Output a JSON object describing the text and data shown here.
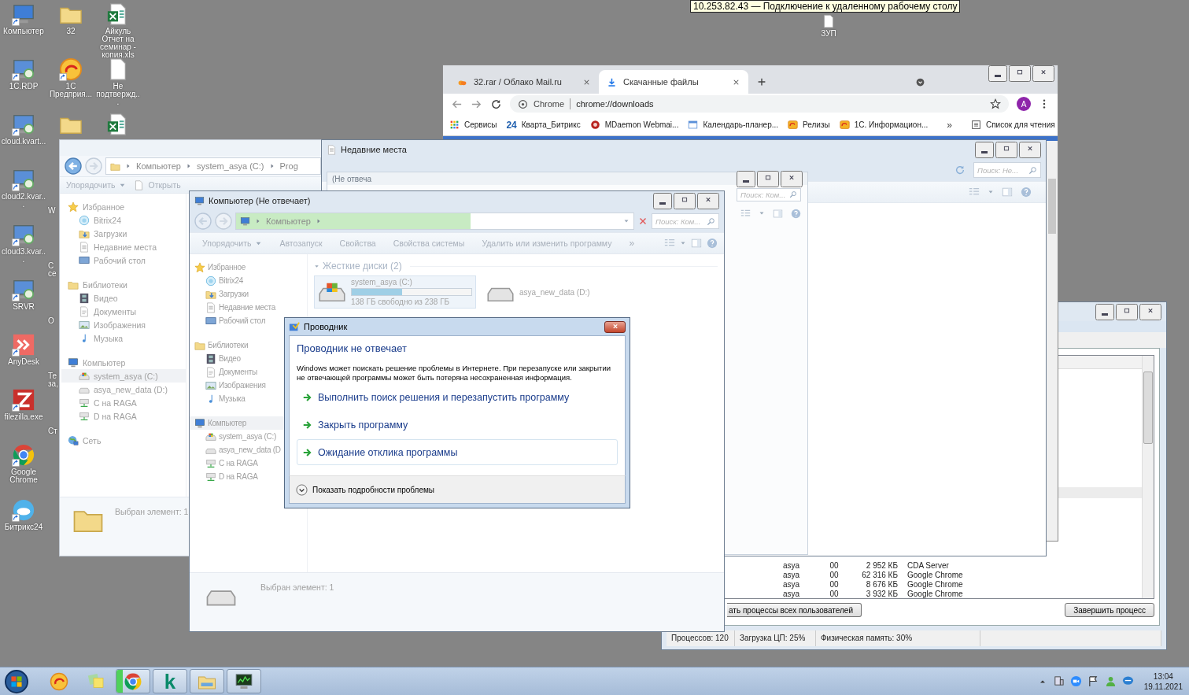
{
  "remote_session": {
    "title": "10.253.82.43 — Подключение к удаленному рабочему столу"
  },
  "desktop_columns": [
    [
      {
        "label": "Компьютер",
        "kind": "computer",
        "shortcut": true
      },
      {
        "label": "1C.RDP",
        "kind": "rdp",
        "shortcut": true
      },
      {
        "label": "cloud.kvart...",
        "kind": "rdp",
        "shortcut": true
      },
      {
        "label": "cloud2.kvar...",
        "kind": "rdp",
        "shortcut": true
      },
      {
        "label": "cloud3.kvar...",
        "kind": "rdp",
        "shortcut": true
      },
      {
        "label": "SRVR",
        "kind": "rdp",
        "shortcut": true
      },
      {
        "label": "AnyDesk",
        "kind": "anydesk",
        "shortcut": true
      },
      {
        "label": "filezilla.exe",
        "kind": "filezilla",
        "shortcut": true
      },
      {
        "label": "Google Chrome",
        "kind": "chrome",
        "shortcut": true
      },
      {
        "label": "Битрикс24",
        "kind": "cloudb",
        "shortcut": true
      }
    ],
    [
      {
        "label": "32",
        "kind": "folder",
        "shortcut": false
      },
      {
        "label": "1С Предприя...",
        "kind": "onec",
        "shortcut": true
      },
      {
        "kind": "folder",
        "shortcut": false
      },
      {
        "label": "W",
        "kind": "hidden",
        "shortcut": false
      },
      {
        "label": "С се",
        "kind": "hidden",
        "shortcut": false
      },
      {
        "label": "О",
        "kind": "hidden",
        "shortcut": false
      },
      {
        "label": "Те за,",
        "kind": "hidden",
        "shortcut": false
      },
      {
        "label": "Ст",
        "kind": "hidden",
        "shortcut": false
      }
    ],
    [
      {
        "label": "Айкуль Отчет на семинар - копия.xls",
        "kind": "excel",
        "shortcut": false
      },
      {
        "label": "Не подтвержд...",
        "kind": "file",
        "shortcut": false
      },
      {
        "kind": "excel",
        "shortcut": false
      }
    ]
  ],
  "desktop_extra_icon": {
    "label": "ЗУП",
    "kind": "file",
    "shortcut": false
  },
  "task_manager": {
    "rows": [
      {
        "cells": [
          "asya",
          "00",
          "2 952 КБ",
          "CDA Server"
        ]
      },
      {
        "cells": [
          "asya",
          "00",
          "62 316 КБ",
          "Google Chrome"
        ]
      },
      {
        "cells": [
          "asya",
          "00",
          "8 676 КБ",
          "Google Chrome"
        ]
      },
      {
        "cells": [
          "asya",
          "00",
          "3 932 КБ",
          "Google Chrome"
        ]
      }
    ],
    "show_all_button": "ать процессы всех пользователей",
    "end_button": "Завершить процесс",
    "status_bar": [
      "Процессов: 120",
      "Загрузка ЦП: 25%",
      "Физическая память: 30%"
    ]
  },
  "browser": {
    "tabs": [
      {
        "title": "32.rar / Облако Mail.ru",
        "kind": "cloud",
        "selected": false
      },
      {
        "title": "Скачанные файлы",
        "kind": "download",
        "selected": true
      }
    ],
    "omnibox": {
      "chip": "Chrome",
      "url": "chrome://downloads"
    },
    "avatar": "A",
    "bookmarks": [
      {
        "label": "Сервисы",
        "kind": "apps"
      },
      {
        "label": "Кварта_Битрикс",
        "kind": "text",
        "icon_text": "24"
      },
      {
        "label": "MDaemon Webmai...",
        "kind": "mdaemon"
      },
      {
        "label": "Календарь-планер...",
        "kind": "calendar"
      },
      {
        "label": "Релизы",
        "kind": "onecsmall"
      },
      {
        "label": "1С. Информацион...",
        "kind": "onecsmall"
      }
    ],
    "more": "»",
    "reading_list": "Список для чтения"
  },
  "left_explorer": {
    "breadcrumb": [
      "Компьютер",
      "system_asya (C:)",
      "Prog"
    ],
    "toolbar": [
      {
        "label": "Упорядочить",
        "kind": "dropdown"
      },
      {
        "label": "Открыть",
        "kind": "open"
      }
    ],
    "nav": [
      {
        "label": "Избранное",
        "kind": "star",
        "selected": false,
        "children": [
          {
            "label": "Bitrix24",
            "kind": "bitrix",
            "selected": false
          },
          {
            "label": "Загрузки",
            "kind": "downloads",
            "selected": false
          },
          {
            "label": "Недавние места",
            "kind": "recent",
            "selected": false
          },
          {
            "label": "Рабочий стол",
            "kind": "desktop",
            "selected": false
          }
        ]
      },
      {
        "label": "Библиотеки",
        "kind": "library",
        "selected": false,
        "children": [
          {
            "label": "Видео",
            "kind": "video",
            "selected": false
          },
          {
            "label": "Документы",
            "kind": "docs",
            "selected": false
          },
          {
            "label": "Изображения",
            "kind": "images",
            "selected": false
          },
          {
            "label": "Музыка",
            "kind": "music",
            "selected": false
          }
        ]
      },
      {
        "label": "Компьютер",
        "kind": "computer",
        "selected": false,
        "children": [
          {
            "label": "system_asya (C:)",
            "kind": "drivec",
            "selected": true
          },
          {
            "label": "asya_new_data (D:)",
            "kind": "drive",
            "selected": false
          },
          {
            "label": "C на RAGA",
            "kind": "netdrive",
            "selected": false
          },
          {
            "label": "D на RAGA",
            "kind": "netdrive",
            "selected": false
          }
        ]
      },
      {
        "label": "Сеть",
        "kind": "network",
        "selected": false
      }
    ],
    "status": "Выбран элемент: 1"
  },
  "recent_window": {
    "title": "Недавние места",
    "search": {
      "placeholder": "Поиск: Не..."
    },
    "inner_window": {
      "title": "(Не отвеча",
      "search": {
        "placeholder": "Поиск: Ком..."
      }
    }
  },
  "main_explorer": {
    "title": "Компьютер (Не отвечает)",
    "breadcrumb": [
      "Компьютер"
    ],
    "level": 0.59,
    "search": {
      "placeholder": "Поиск: Ком..."
    },
    "toolbar": [
      {
        "label": "Упорядочить",
        "kind": "dropdown"
      },
      {
        "label": "Автозапуск",
        "kind": "plain"
      },
      {
        "label": "Свойства",
        "kind": "plain"
      },
      {
        "label": "Свойства системы",
        "kind": "plain"
      },
      {
        "label": "Удалить или изменить программу",
        "kind": "plain"
      }
    ],
    "more": "»",
    "nav": [
      {
        "label": "Избранное",
        "kind": "star",
        "selected": false,
        "children": [
          {
            "label": "Bitrix24",
            "kind": "bitrix",
            "selected": false
          },
          {
            "label": "Загрузки",
            "kind": "downloads",
            "selected": false
          },
          {
            "label": "Недавние места",
            "kind": "recent",
            "selected": false
          },
          {
            "label": "Рабочий стол",
            "kind": "desktop",
            "selected": false
          }
        ]
      },
      {
        "label": "Библиотеки",
        "kind": "library",
        "selected": false,
        "children": [
          {
            "label": "Видео",
            "kind": "video",
            "selected": false
          },
          {
            "label": "Документы",
            "kind": "docs",
            "selected": false
          },
          {
            "label": "Изображения",
            "kind": "images",
            "selected": false
          },
          {
            "label": "Музыка",
            "kind": "music",
            "selected": false
          }
        ]
      },
      {
        "label": "Компьютер",
        "kind": "computer",
        "selected": true,
        "children": [
          {
            "label": "system_asya (C:)",
            "kind": "drivec",
            "selected": false
          },
          {
            "label": "asya_new_data (D",
            "kind": "drive",
            "selected": false
          },
          {
            "label": "C на RAGA",
            "kind": "netdrive",
            "selected": false
          },
          {
            "label": "D на RAGA",
            "kind": "netdrive",
            "selected": false
          }
        ]
      }
    ],
    "group": "Жесткие диски (2)",
    "drives": [
      {
        "name": "system_asya (C:)",
        "kind": "drivec",
        "level": 0.42,
        "free": "138 ГБ свободно из 238 ГБ",
        "selected": true
      },
      {
        "name": "asya_new_data (D:)",
        "kind": "drive",
        "selected": false
      }
    ],
    "status": "Выбран элемент: 1"
  },
  "dialog": {
    "title": "Проводник",
    "heading": "Проводник не отвечает",
    "text": "Windows может поискать решение проблемы в Интернете. При перезапуске или закрытии не отвечающей программы может быть потеряна несохраненная информация.",
    "options": [
      {
        "label": "Выполнить поиск решения и перезапустить программу",
        "selected": false
      },
      {
        "label": "Закрыть программу",
        "selected": false
      },
      {
        "label": "Ожидание отклика программы",
        "selected": true
      }
    ],
    "details": "Показать подробности проблемы"
  },
  "taskbar": {
    "items": [
      {
        "kind": "onec",
        "running": false
      },
      {
        "kind": "sticky",
        "running": false
      },
      {
        "kind": "chrome",
        "running": true,
        "level": 0.2
      },
      {
        "kind": "text",
        "icon_text": "k",
        "running": true
      },
      {
        "kind": "folderopen",
        "running": true
      },
      {
        "kind": "taskmgr",
        "running": true
      }
    ],
    "time": "13:04",
    "date": "19.11.2021"
  }
}
